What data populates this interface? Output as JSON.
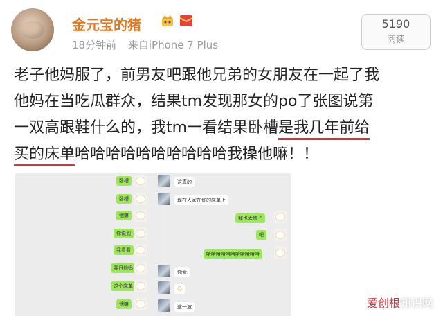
{
  "post": {
    "username": "金元宝的猪",
    "time_ago": "18分钟前",
    "source": "来自iPhone 7 Plus",
    "read_count": "5190",
    "read_label": "阅读",
    "lines": [
      "老子他妈服了，前男友吧跟他兄弟的女朋友在一起了我",
      "他妈在当吃瓜群众，结果tm发现那女的po了张图说第",
      "一双高跟鞋什么的，我tm一看结果卧槽",
      "是我几年前给",
      "买的床单",
      "哈哈哈哈哈哈哈哈哈哈我操他嘛！！"
    ]
  },
  "chat_left_column": [
    {
      "text": "卧槽",
      "side": "right"
    },
    {
      "text": "他嘛",
      "side": "right"
    },
    {
      "text": "你说到",
      "side": "right"
    },
    {
      "text": "我看看",
      "side": "right"
    },
    {
      "text": "我日他妈",
      "side": "right"
    },
    {
      "text": "这个床单",
      "side": "right"
    },
    {
      "text": "他嘛",
      "side": "right"
    }
  ],
  "chat_right_column": [
    {
      "text": "这真的",
      "side": "left"
    },
    {
      "text": "现在人家在你的床单上",
      "side": "left"
    },
    {
      "text": "我也太惨了",
      "side": "right"
    },
    {
      "text": "吧",
      "side": "right"
    },
    {
      "text": "哈哈哈哈哈哈哈哈哈哈哈",
      "side": "right"
    },
    {
      "text": "你爱",
      "side": "left"
    },
    {
      "text": "☺",
      "side": "left"
    },
    {
      "text": "这一波",
      "side": "left"
    }
  ],
  "watermark": {
    "part1": "爱创根",
    "part2": "知识网"
  },
  "colors": {
    "username": "#e07a26",
    "underline": "#d6333a",
    "bubble_green": "#9ee65f"
  }
}
